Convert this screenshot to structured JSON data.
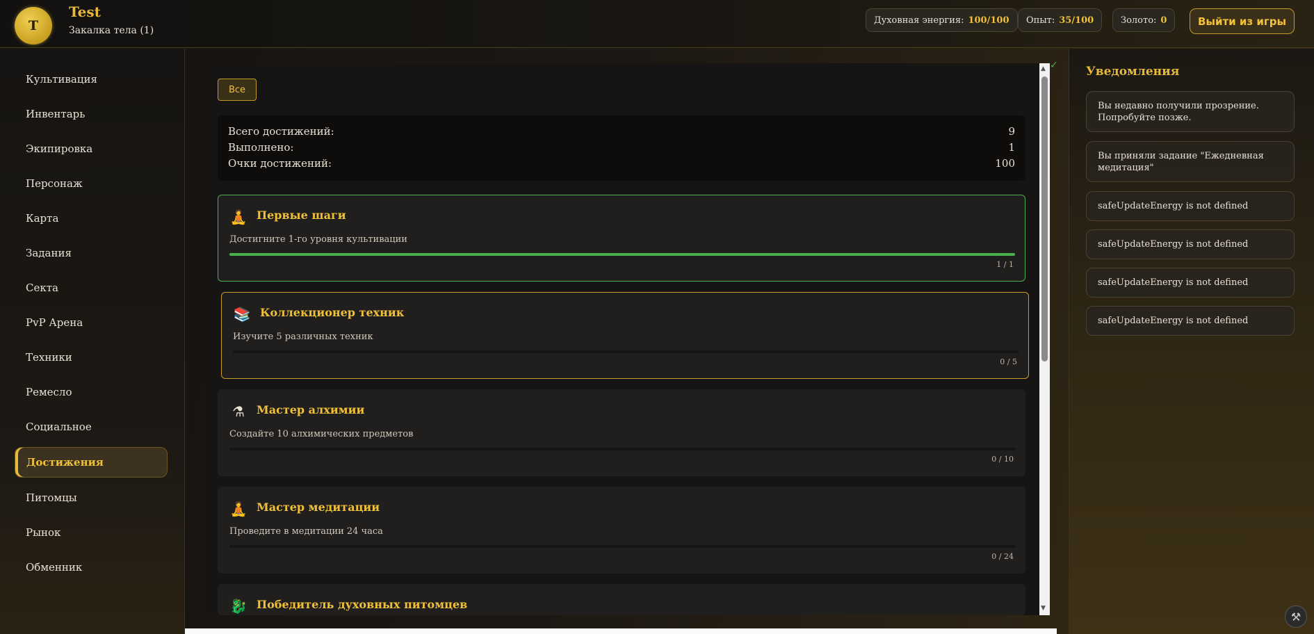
{
  "header": {
    "avatar_letter": "T",
    "player_name": "Test",
    "player_rank": "Закалка тела (1)",
    "stats": [
      {
        "label": "Духовная энергия:",
        "value": "100/100"
      },
      {
        "label": "Опыт:",
        "value": "35/100"
      },
      {
        "label": "Золото:",
        "value": "0"
      }
    ],
    "exit_label": "Выйти из игры"
  },
  "sidebar": {
    "items": [
      {
        "label": "Культивация"
      },
      {
        "label": "Инвентарь"
      },
      {
        "label": "Экипировка"
      },
      {
        "label": "Персонаж"
      },
      {
        "label": "Карта"
      },
      {
        "label": "Задания"
      },
      {
        "label": "Секта"
      },
      {
        "label": "PvP Арена"
      },
      {
        "label": "Техники"
      },
      {
        "label": "Ремесло"
      },
      {
        "label": "Социальное"
      },
      {
        "label": "Достижения",
        "active": true
      },
      {
        "label": "Питомцы"
      },
      {
        "label": "Рынок"
      },
      {
        "label": "Обменник"
      }
    ]
  },
  "main": {
    "filter_label": "Все",
    "summary": {
      "total_label": "Всего достижений:",
      "total_value": "9",
      "done_label": "Выполнено:",
      "done_value": "1",
      "points_label": "Очки достижений:",
      "points_value": "100"
    },
    "achievements": [
      {
        "icon": "meditation-icon",
        "glyph": "🧘",
        "title": "Первые шаги",
        "desc": "Достигните 1-го уровня культивации",
        "progress": "1 / 1",
        "fraction": 1.0,
        "state": "done"
      },
      {
        "icon": "books-icon",
        "glyph": "📚",
        "title": "Коллекционер техник",
        "desc": "Изучите 5 различных техник",
        "progress": "0 / 5",
        "fraction": 0.0,
        "state": "hover"
      },
      {
        "icon": "alchemy-flask-icon",
        "glyph": "⚗",
        "title": "Мастер алхимии",
        "desc": "Создайте 10 алхимических предметов",
        "progress": "0 / 10",
        "fraction": 0.0,
        "state": "normal"
      },
      {
        "icon": "meditation-icon",
        "glyph": "🧘",
        "title": "Мастер медитации",
        "desc": "Проведите в медитации 24 часа",
        "progress": "0 / 24",
        "fraction": 0.0,
        "state": "normal"
      },
      {
        "icon": "dragon-icon",
        "glyph": "🐉",
        "title": "Победитель духовных питомцев",
        "desc": "",
        "progress": "",
        "fraction": 0.0,
        "state": "normal"
      }
    ]
  },
  "notifications": {
    "title": "Уведомления",
    "items": [
      "Вы недавно получили прозрение. Попробуйте позже.",
      "Вы приняли задание \"Ежедневная медитация\"",
      "safeUpdateEnergy is not defined",
      "safeUpdateEnergy is not defined",
      "safeUpdateEnergy is not defined",
      "safeUpdateEnergy is not defined"
    ]
  },
  "colors": {
    "accent": "#f0c038",
    "success": "#4caf50"
  }
}
